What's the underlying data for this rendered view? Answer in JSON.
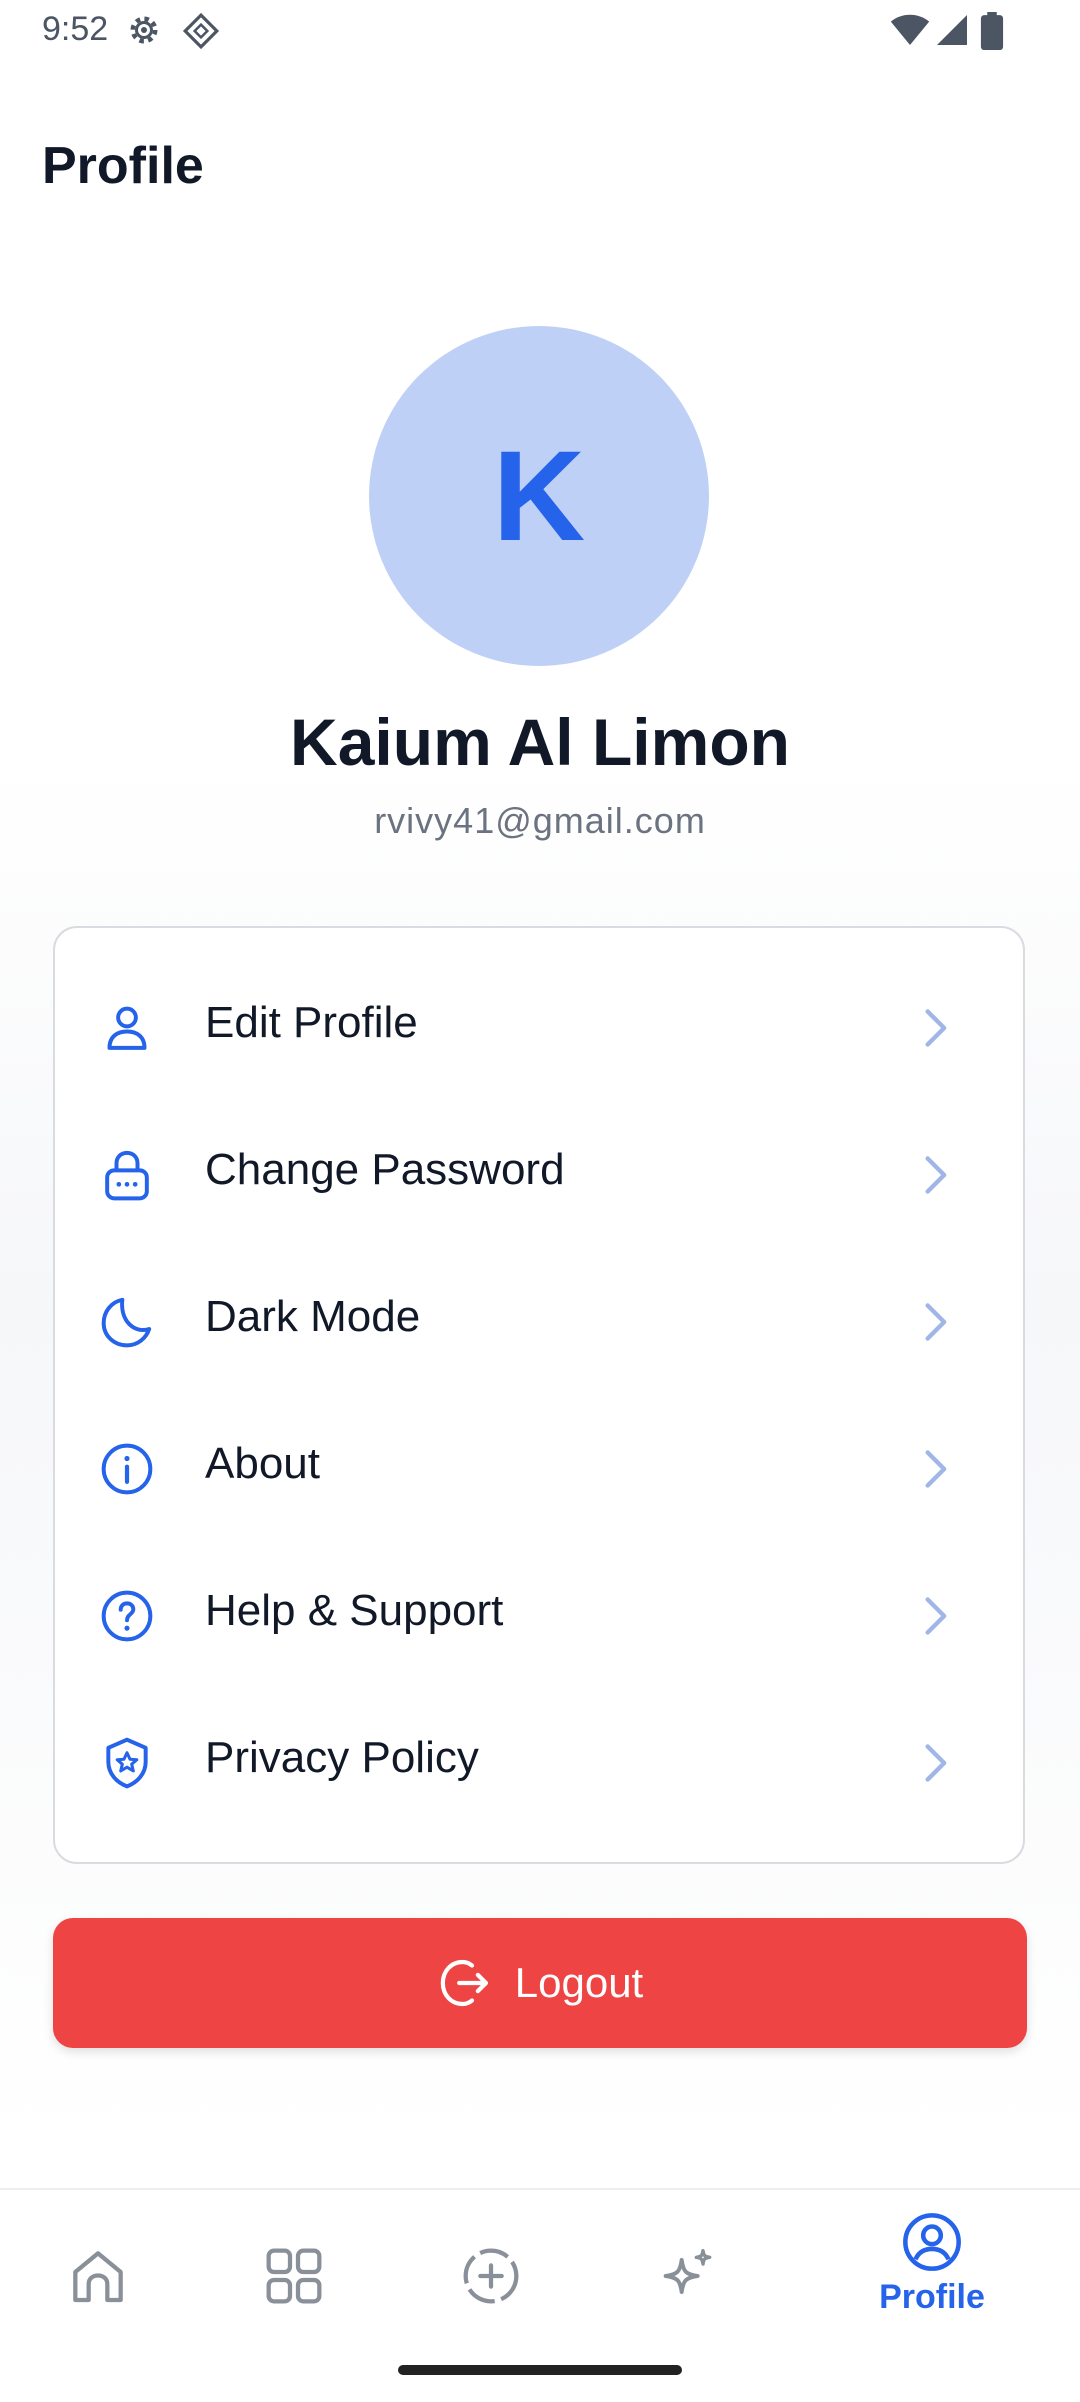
{
  "status_bar": {
    "time": "9:52"
  },
  "header": {
    "title": "Profile"
  },
  "profile": {
    "initial": "K",
    "name": "Kaium Al Limon",
    "email": "rvivy41@gmail.com"
  },
  "menu": {
    "items": [
      {
        "label": "Edit Profile",
        "icon": "user-icon"
      },
      {
        "label": "Change Password",
        "icon": "lock-icon"
      },
      {
        "label": "Dark Mode",
        "icon": "moon-icon"
      },
      {
        "label": "About",
        "icon": "info-icon"
      },
      {
        "label": "Help & Support",
        "icon": "help-icon"
      },
      {
        "label": "Privacy Policy",
        "icon": "shield-icon"
      }
    ]
  },
  "logout": {
    "label": "Logout"
  },
  "bottom_nav": {
    "items": [
      {
        "icon": "home-icon"
      },
      {
        "icon": "grid-icon"
      },
      {
        "icon": "add-circle-icon"
      },
      {
        "icon": "sparkle-icon"
      },
      {
        "icon": "profile-icon",
        "label": "Profile",
        "active": true
      }
    ]
  },
  "colors": {
    "accent": "#2563eb",
    "danger": "#ef4444",
    "avatar_bg": "#bfd0f7"
  }
}
